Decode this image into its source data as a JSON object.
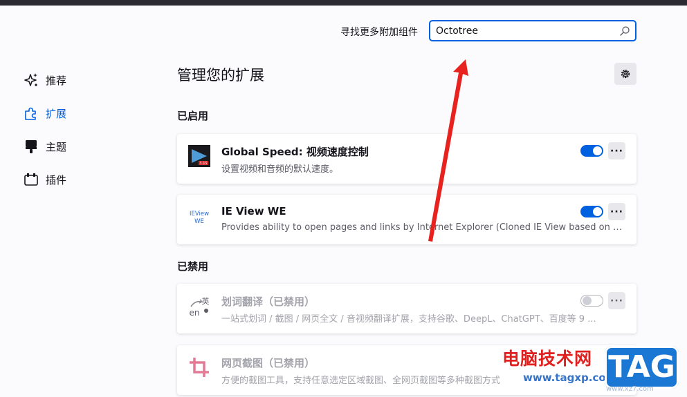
{
  "header": {
    "search_label": "寻找更多附加组件",
    "search_value": "Octotree"
  },
  "nav": {
    "items": [
      {
        "label": "推荐",
        "icon": "sparkle-icon"
      },
      {
        "label": "扩展",
        "icon": "puzzle-icon",
        "active": true
      },
      {
        "label": "主题",
        "icon": "paintbrush-icon"
      },
      {
        "label": "插件",
        "icon": "plugin-icon"
      }
    ]
  },
  "main": {
    "title": "管理您的扩展",
    "enabled_heading": "已启用",
    "disabled_heading": "已禁用",
    "enabled": [
      {
        "name": "Global Speed: 视频速度控制",
        "desc": "设置视频和音频的默认速度。",
        "icon": "global-speed-icon",
        "enabled": true
      },
      {
        "name": "IE View WE",
        "desc": "Provides ability to open pages and links by Internet Explorer (Cloned IE View based on WebExtensions API)",
        "icon": "ieview-icon",
        "icon_text_line1": "IEView",
        "icon_text_line2": "WE",
        "enabled": true
      }
    ],
    "disabled": [
      {
        "name": "划词翻译（已禁用）",
        "desc": "一站式划词 / 截图 / 网页全文 / 音视频翻译扩展，支持谷歌、DeepL、ChatGPT、百度等 9 ...",
        "icon": "translate-icon",
        "icon_text_line1": "英",
        "icon_text_line2": "en",
        "enabled": false
      },
      {
        "name": "网页截图（已禁用）",
        "desc": "方便的截图工具，支持任意选定区域截图、全网页截图等多种截图方式",
        "icon": "crop-icon",
        "enabled": false
      }
    ],
    "more_label": "···"
  },
  "watermark": {
    "line1": "电脑技术网",
    "line2": "www.tagxp.com",
    "tag": "TAG",
    "sub": "www.xz7.com"
  },
  "colors": {
    "accent": "#0061e0",
    "annotation_arrow": "#e8231f"
  }
}
